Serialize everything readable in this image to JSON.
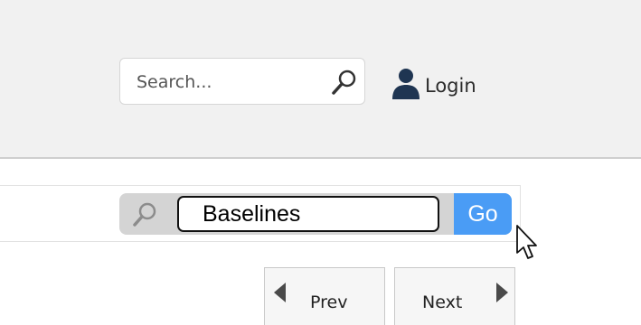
{
  "header": {
    "search": {
      "placeholder": "Search..."
    },
    "login_label": "Login"
  },
  "search_bar": {
    "query": "Baselines",
    "go_label": "Go"
  },
  "pagination": {
    "prev_label": "Prev",
    "next_label": "Next"
  },
  "colors": {
    "header_bg": "#f1f1f1",
    "go_button_bg": "#4a9cf5",
    "user_icon": "#1f3552"
  },
  "icons": {
    "header_search": "search-icon",
    "login": "user-icon",
    "search_bar": "magnifier-icon",
    "prev": "arrow-left-icon",
    "next": "arrow-right-icon"
  }
}
